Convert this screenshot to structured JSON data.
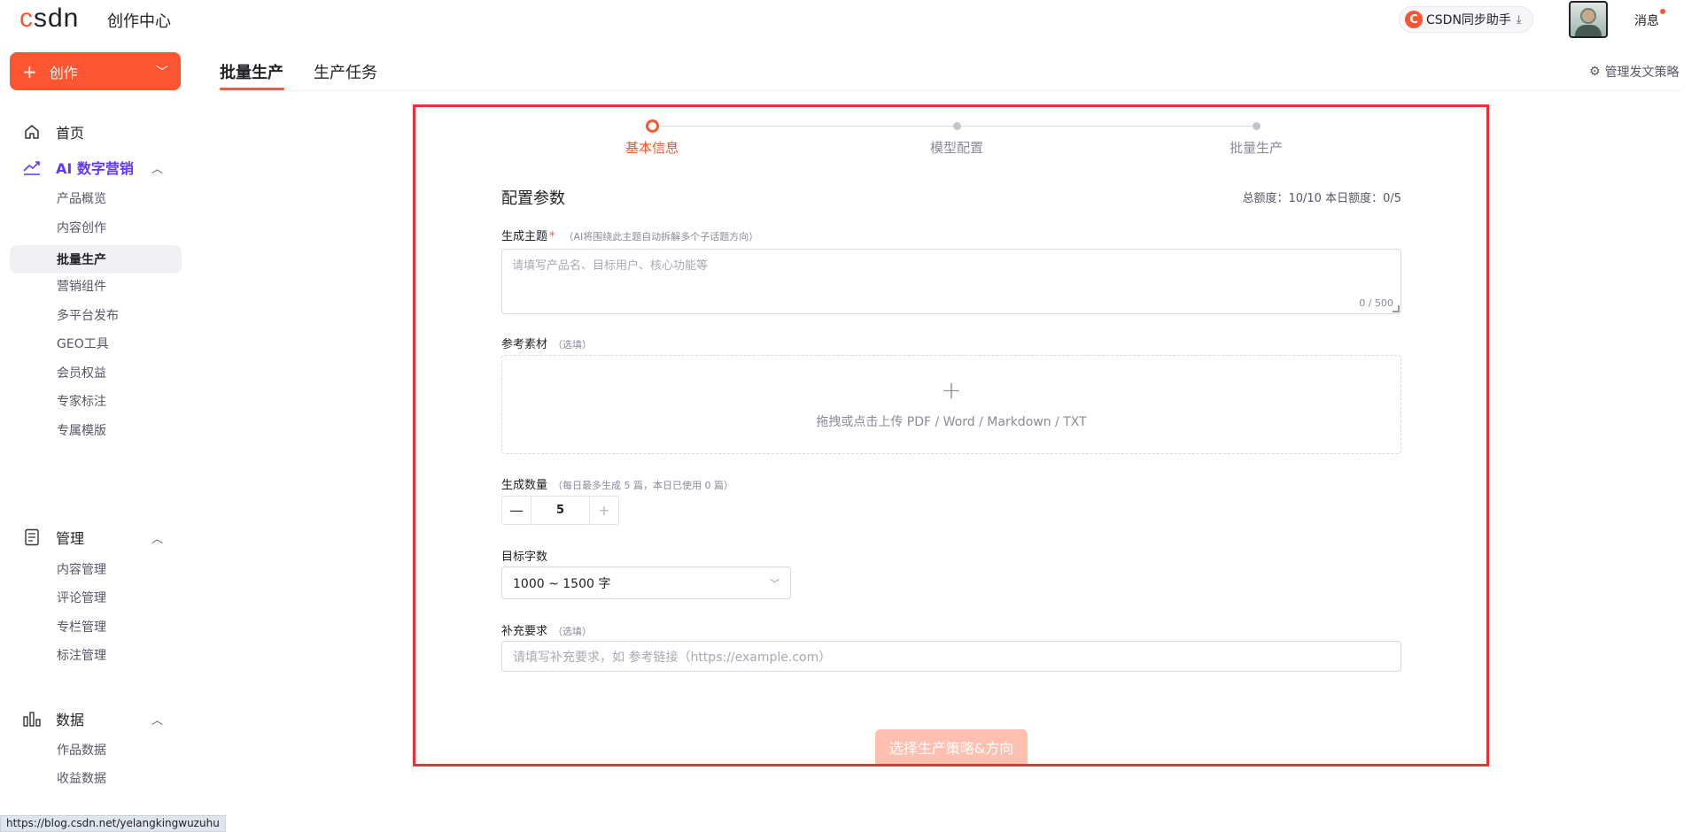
{
  "header": {
    "logo": "csdn",
    "site_title": "创作中心",
    "helper_label": "CSDN同步助手",
    "helper_icon": "download-icon",
    "message_label": "消息"
  },
  "sidebar": {
    "create_label": "创作",
    "items": [
      {
        "label": "首页",
        "icon": "home-icon"
      },
      {
        "label": "AI 数字营销",
        "icon": "trend-chart-icon",
        "expanded": true
      },
      {
        "label": "产品概览"
      },
      {
        "label": "内容创作"
      },
      {
        "label": "批量生产",
        "selected": true
      },
      {
        "label": "营销组件"
      },
      {
        "label": "多平台发布"
      },
      {
        "label": "GEO工具"
      },
      {
        "label": "会员权益"
      },
      {
        "label": "专家标注"
      },
      {
        "label": "专属模版"
      },
      {
        "label": "管理",
        "icon": "document-icon",
        "expanded": true
      },
      {
        "label": "内容管理"
      },
      {
        "label": "评论管理"
      },
      {
        "label": "专栏管理"
      },
      {
        "label": "标注管理"
      },
      {
        "label": "数据",
        "icon": "bar-chart-icon",
        "expanded": true
      },
      {
        "label": "作品数据"
      },
      {
        "label": "收益数据"
      }
    ]
  },
  "status_url": "https://blog.csdn.net/yelangkingwuzuhu",
  "tabs": [
    {
      "label": "批量生产",
      "active": true
    },
    {
      "label": "生产任务",
      "active": false
    }
  ],
  "strategy_label": "管理发文策略",
  "steps": [
    {
      "label": "基本信息",
      "current": true
    },
    {
      "label": "模型配置",
      "current": false
    },
    {
      "label": "批量生产",
      "current": false
    }
  ],
  "form": {
    "section_title": "配置参数",
    "quota": "总额度：10/10 本日额度：0/5",
    "topic": {
      "label": "生成主题",
      "required_mark": "*",
      "hint": "（AI将围绕此主题自动拆解多个子话题方向）",
      "placeholder": "请填写产品名、目标用户、核心功能等",
      "counter": "0 / 500"
    },
    "material": {
      "label": "参考素材",
      "hint": "（选填）",
      "upload_text": "拖拽或点击上传 PDF / Word / Markdown / TXT"
    },
    "count": {
      "label": "生成数量",
      "hint": "（每日最多生成 5 篇，本日已使用 0 篇）",
      "value": "5"
    },
    "word_count": {
      "label": "目标字数",
      "selected": "1000 ~ 1500 字"
    },
    "extra": {
      "label": "补充要求",
      "hint": "（选填）",
      "placeholder": "请填写补充要求，如 参考链接（https://example.com）"
    },
    "submit_label": "选择生产策略&方向"
  },
  "colors": {
    "accent": "#fc5531",
    "ai_purple": "#6236ff",
    "highlight_border": "#e8303a",
    "submit_disabled": "#ffc0b1"
  }
}
